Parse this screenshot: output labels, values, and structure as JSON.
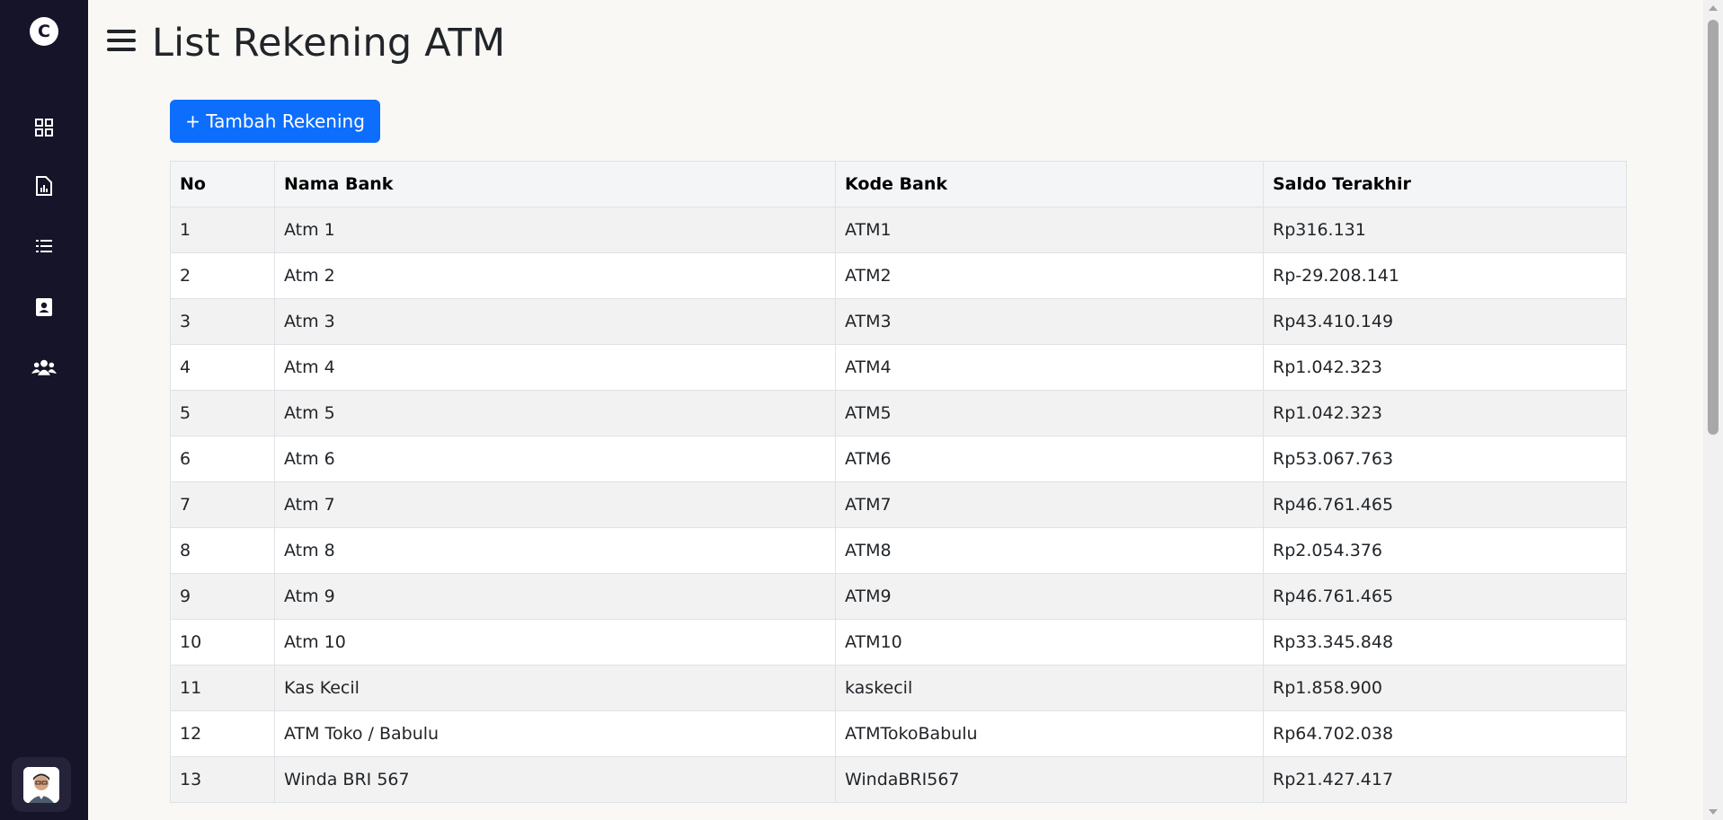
{
  "sidebar": {
    "logo_text": "C",
    "nav": [
      {
        "icon": "dashboard-grid-icon"
      },
      {
        "icon": "report-file-icon"
      },
      {
        "icon": "list-icon"
      },
      {
        "icon": "contact-card-icon"
      },
      {
        "icon": "users-group-icon"
      }
    ],
    "avatar_icon": "user-avatar-icon",
    "bg_color": "#161428"
  },
  "header": {
    "title": "List Rekening ATM"
  },
  "actions": {
    "add_label": "+ Tambah Rekening",
    "accent_color": "#0d6efd"
  },
  "table": {
    "headers": [
      "No",
      "Nama Bank",
      "Kode Bank",
      "Saldo Terakhir"
    ],
    "rows": [
      [
        "1",
        "Atm 1",
        "ATM1",
        "Rp316.131"
      ],
      [
        "2",
        "Atm 2",
        "ATM2",
        "Rp-29.208.141"
      ],
      [
        "3",
        "Atm 3",
        "ATM3",
        "Rp43.410.149"
      ],
      [
        "4",
        "Atm 4",
        "ATM4",
        "Rp1.042.323"
      ],
      [
        "5",
        "Atm 5",
        "ATM5",
        "Rp1.042.323"
      ],
      [
        "6",
        "Atm 6",
        "ATM6",
        "Rp53.067.763"
      ],
      [
        "7",
        "Atm 7",
        "ATM7",
        "Rp46.761.465"
      ],
      [
        "8",
        "Atm 8",
        "ATM8",
        "Rp2.054.376"
      ],
      [
        "9",
        "Atm 9",
        "ATM9",
        "Rp46.761.465"
      ],
      [
        "10",
        "Atm 10",
        "ATM10",
        "Rp33.345.848"
      ],
      [
        "11",
        "Kas Kecil",
        "kaskecil",
        "Rp1.858.900"
      ],
      [
        "12",
        "ATM Toko / Babulu",
        "ATMTokoBabulu",
        "Rp64.702.038"
      ],
      [
        "13",
        "Winda BRI 567",
        "WindaBRI567",
        "Rp21.427.417"
      ]
    ]
  }
}
